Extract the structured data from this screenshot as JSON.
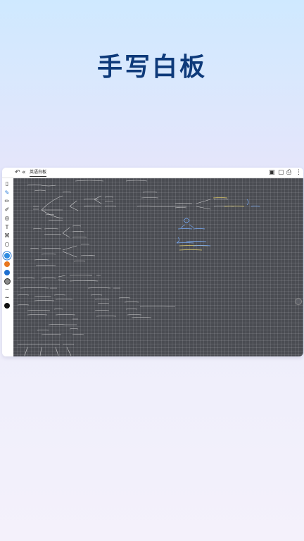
{
  "headline": "手写白板",
  "topbar": {
    "menu_icon": "☰",
    "undo_icon": "↶",
    "back_icon": "«",
    "doc_title": "英语白板",
    "save_icon": "▣",
    "lock_icon": "▢",
    "export_icon": "⎙",
    "more_icon": "⋮"
  },
  "toolbar": {
    "tools": [
      {
        "name": "page-icon",
        "glyph": "▯"
      },
      {
        "name": "pen-icon",
        "glyph": "✎"
      },
      {
        "name": "pencil-icon",
        "glyph": "✏"
      },
      {
        "name": "marker-icon",
        "glyph": "✐"
      },
      {
        "name": "lasso-icon",
        "glyph": "◎"
      },
      {
        "name": "text-icon",
        "glyph": "T"
      },
      {
        "name": "shapes-icon",
        "glyph": "⌘"
      },
      {
        "name": "search-icon",
        "glyph": "○"
      }
    ],
    "colors": [
      "#2f8be0",
      "#e8761f",
      "#1f6fd0",
      "#777777"
    ],
    "stroke_samples": [
      "~",
      "~",
      "~"
    ],
    "black_color": "#111111"
  },
  "colors": {
    "accent": "#2b7bd8",
    "canvas_bg": "#4a4c52",
    "ink": "#e8e8e8",
    "ink_yellow": "#e8d36a",
    "ink_blue": "#7ab0ff"
  }
}
